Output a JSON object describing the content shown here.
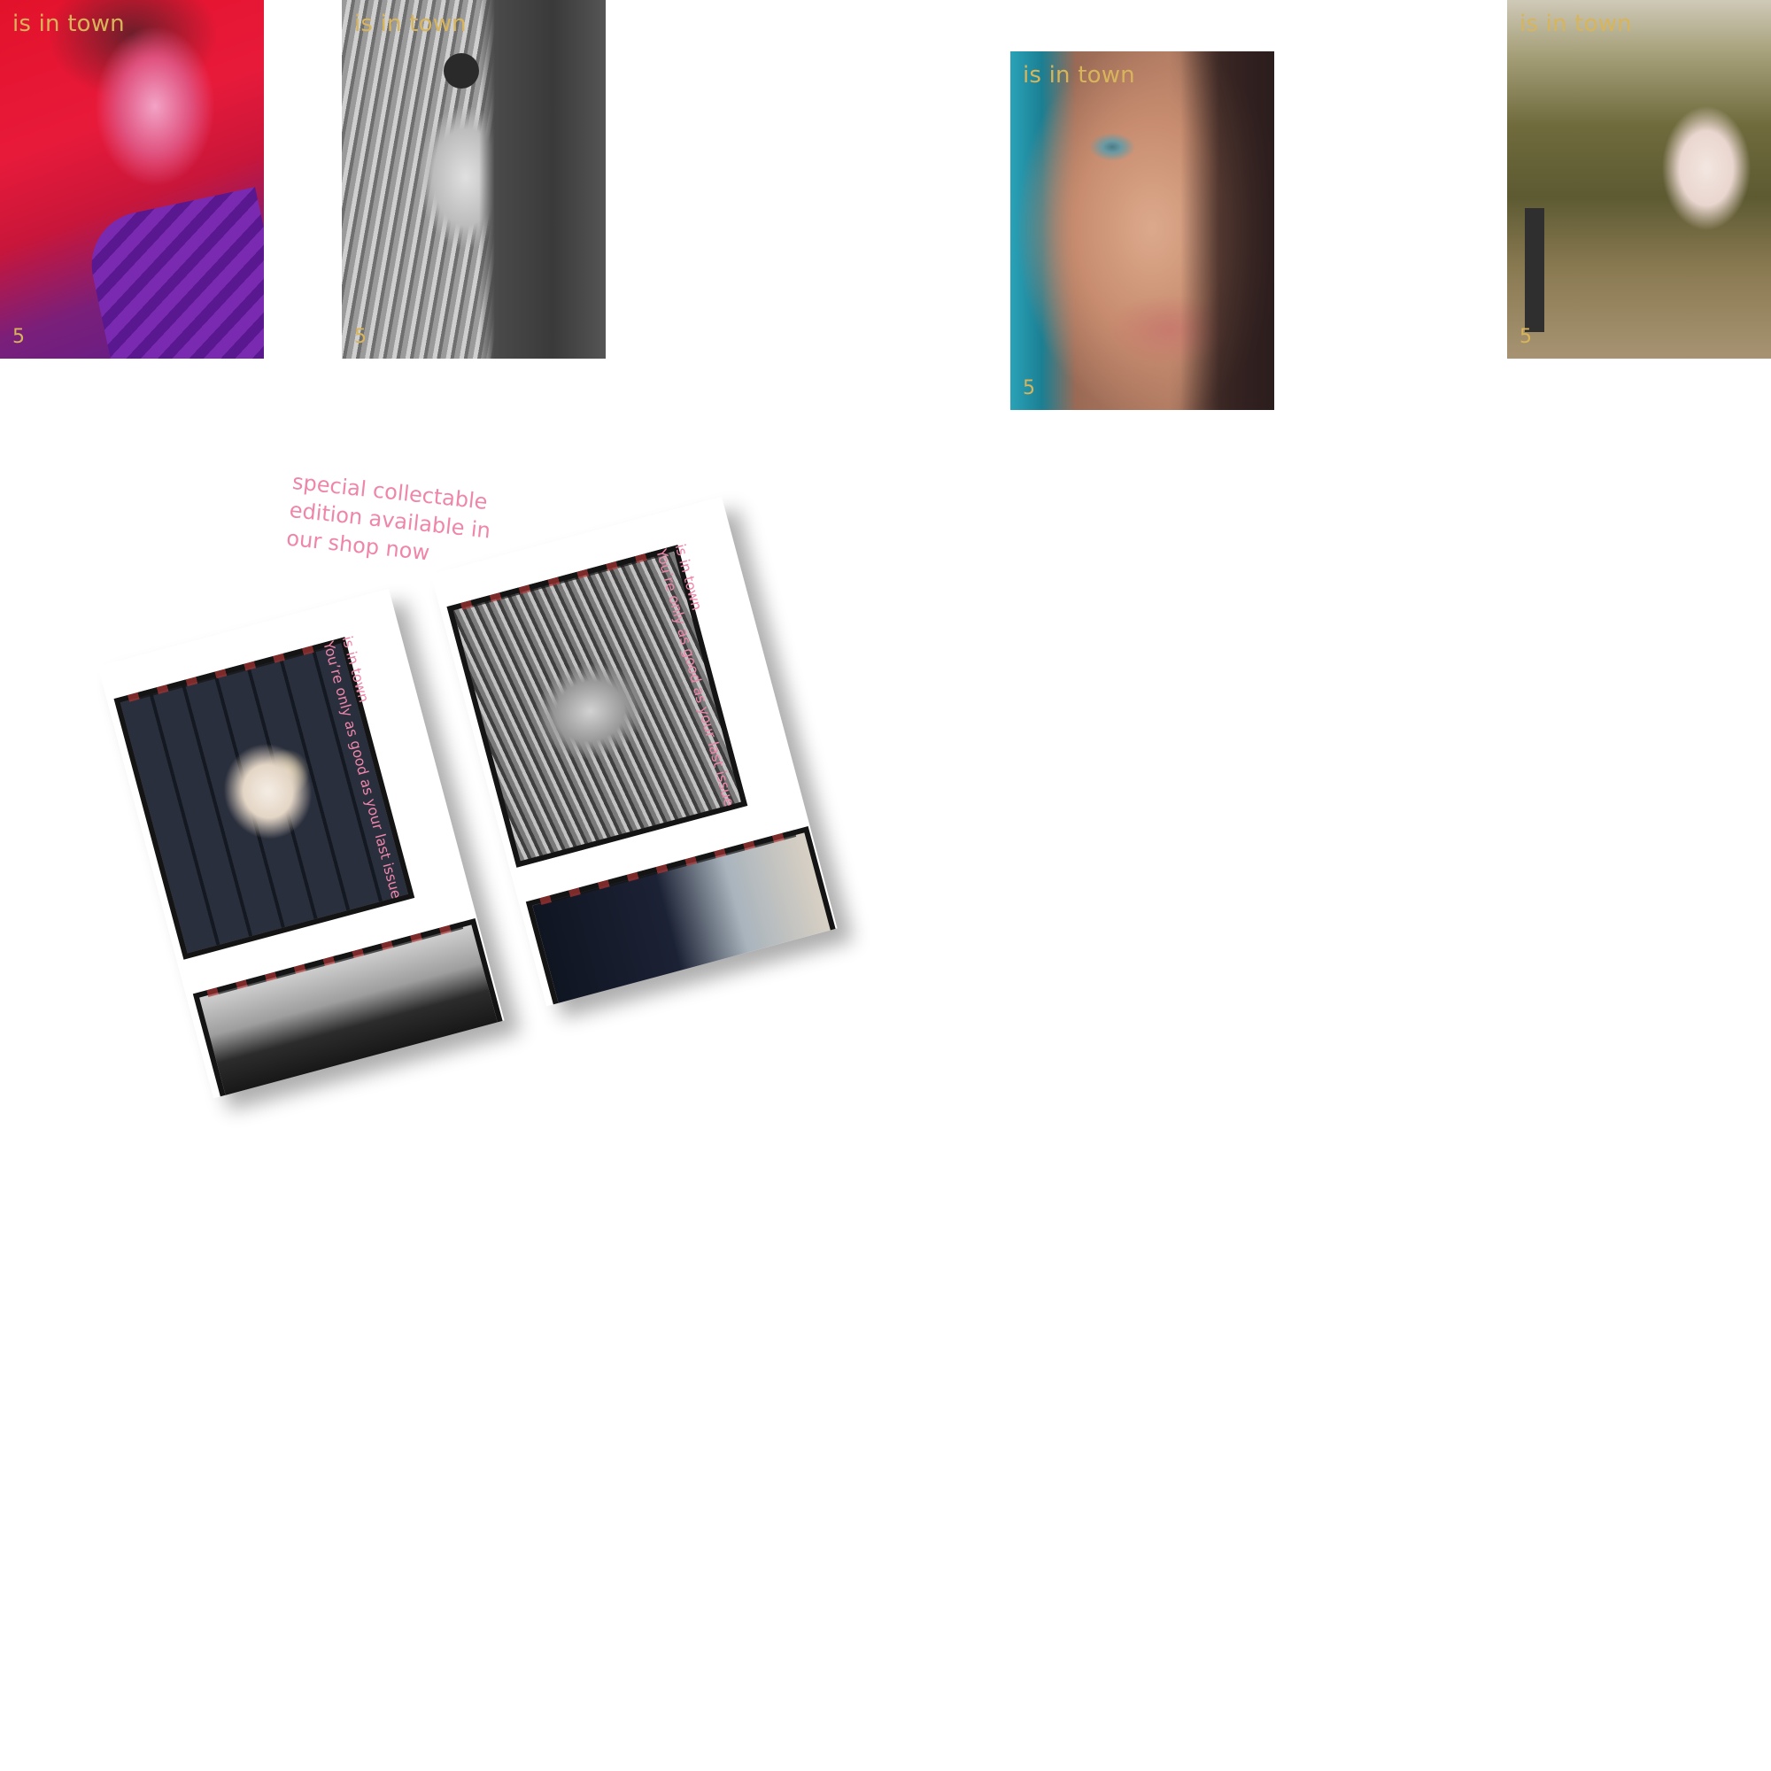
{
  "covers": [
    {
      "title": "is in town",
      "issue": "5"
    },
    {
      "title": "is in town",
      "issue": "5"
    },
    {
      "title": "is in town",
      "issue": "5"
    },
    {
      "title": "is in town",
      "issue": "5"
    }
  ],
  "promo": {
    "line_1": "special collectable",
    "line_2": "edition available in",
    "line_3": "our shop now"
  },
  "booklet": [
    {
      "title": "is in town",
      "tagline": "You’re only as good as your last issue"
    },
    {
      "title": "is in town",
      "tagline": "You’re only as good as your last issue"
    }
  ],
  "colors": {
    "cover_text": "#d8b45a",
    "pink_text": "#ef86aa",
    "background": "#ffffff"
  }
}
